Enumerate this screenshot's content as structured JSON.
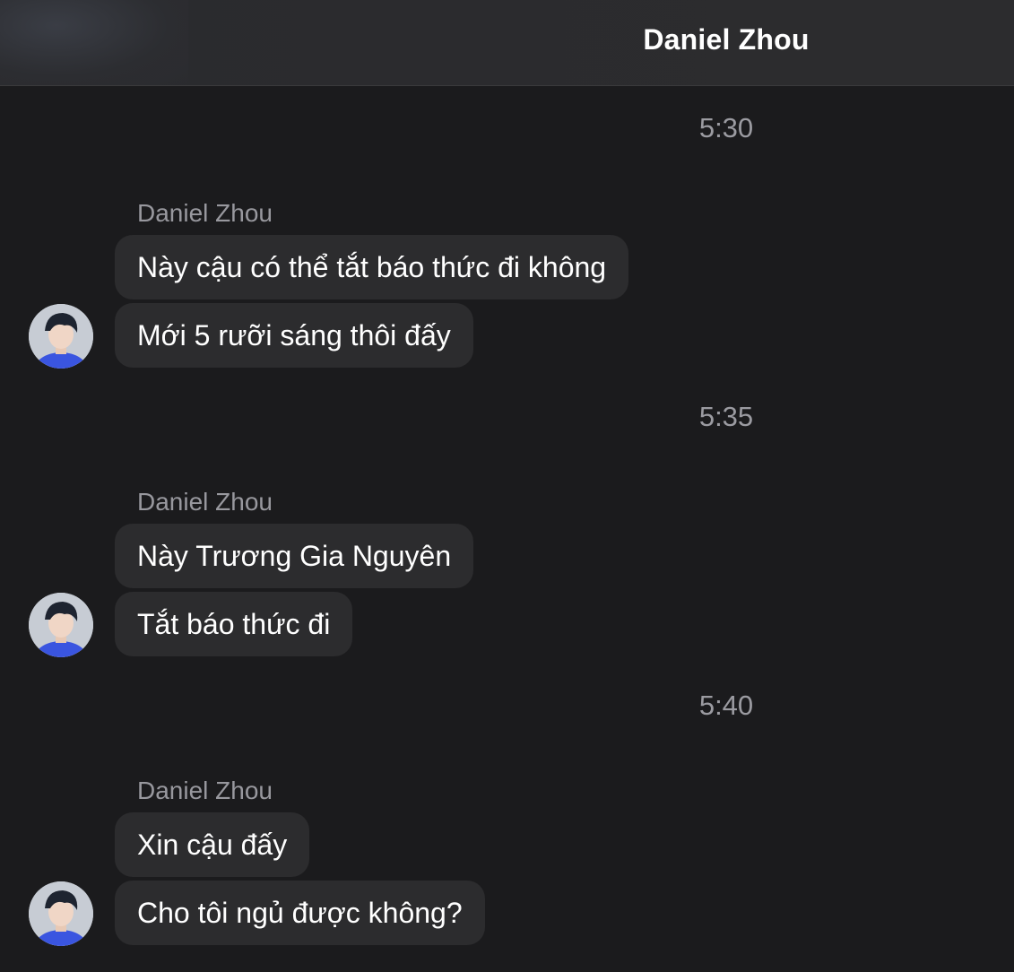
{
  "header": {
    "title": "Daniel Zhou"
  },
  "groups": [
    {
      "time": "5:30",
      "sender": "Daniel Zhou",
      "messages": [
        "Này cậu có thể tắt báo thức đi không",
        "Mới 5 rưỡi sáng thôi đấy"
      ]
    },
    {
      "time": "5:35",
      "sender": "Daniel Zhou",
      "messages": [
        "Này Trương Gia Nguyên",
        "Tắt báo thức đi"
      ]
    },
    {
      "time": "5:40",
      "sender": "Daniel Zhou",
      "messages": [
        "Xin cậu đấy",
        "Cho tôi ngủ được không?"
      ]
    }
  ],
  "colors": {
    "background": "#1b1b1d",
    "bubble": "#2c2c2e",
    "muted_text": "#98989e",
    "avatar_shirt": "#3a55e0"
  }
}
